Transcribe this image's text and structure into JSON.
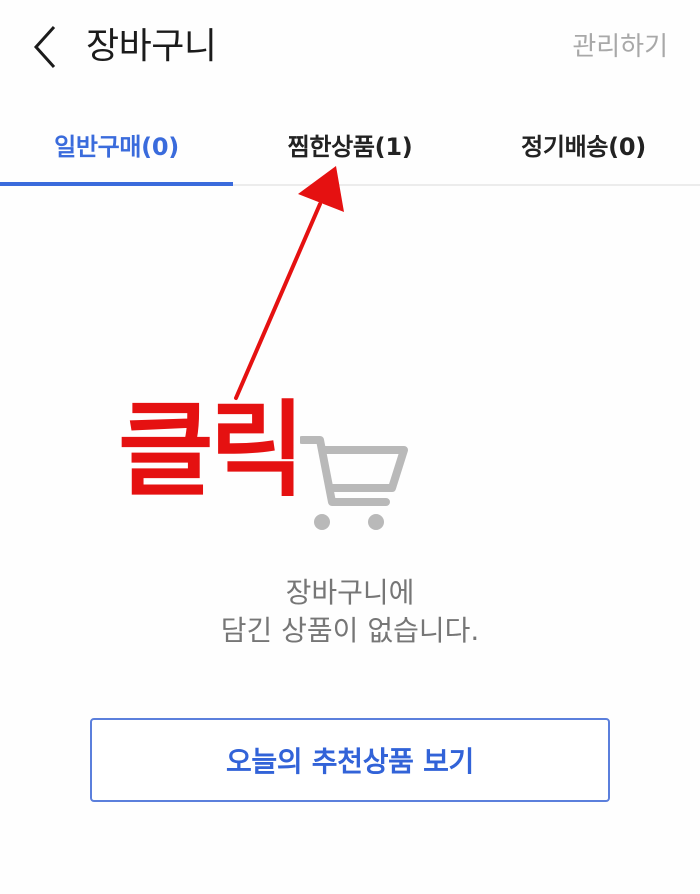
{
  "header": {
    "title": "장바구니",
    "manage_label": "관리하기"
  },
  "tabs": [
    {
      "label": "일반구매(0)",
      "active": true
    },
    {
      "label": "찜한상품(1)",
      "active": false
    },
    {
      "label": "정기배송(0)",
      "active": false
    }
  ],
  "empty_state": {
    "line1": "장바구니에",
    "line2": "담긴 상품이 없습니다.",
    "button_label": "오늘의 추천상품 보기"
  },
  "annotation": {
    "label": "클릭",
    "color": "#e51111"
  },
  "colors": {
    "accent": "#3a6bdc",
    "icon_gray": "#b9b9b9"
  },
  "icons": [
    "back-arrow-icon",
    "shopping-cart-icon"
  ]
}
